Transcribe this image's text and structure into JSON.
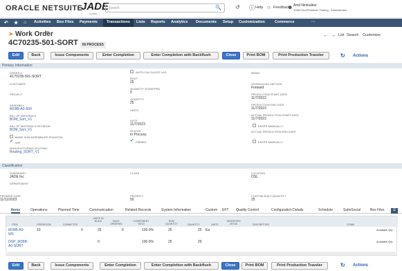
{
  "header": {
    "logo_netsuite": "ORACLE NETSUITE",
    "logo_jade": "JADE",
    "logo_jade_sub": "GLOBAL",
    "search_placeholder": "Search",
    "help": "Help",
    "feedback": "Feedback",
    "user_name": "Amit Nimbalker",
    "user_role": "JLBM Dev/Publisher Trading - Administrator"
  },
  "nav": {
    "items": [
      "Activities",
      "Box Files",
      "Payments",
      "Transactions",
      "Lists",
      "Reports",
      "Analytics",
      "Documents",
      "Setup",
      "Customization",
      "Commerce",
      "···"
    ]
  },
  "page": {
    "type_label": "Work Order",
    "record_number": "4C70235-501-SORT",
    "status_badge": "IN PROCESS",
    "list_link": "List",
    "search_link": "Search",
    "customize_link": "Customize"
  },
  "buttons": {
    "edit": "Edit",
    "back": "Back",
    "issue": "Issue Components",
    "enter_completion": "Enter Completion",
    "enter_backflush": "Enter Completion with Backflush",
    "close": "Close",
    "print_bom": "Print BOM",
    "print_traveler": "Print Production Traveler",
    "actions": "Actions"
  },
  "primary": {
    "section_label": "Primary Information",
    "order_label": "ORDER #",
    "order_value": "4C70235-501-SORT",
    "customer_label": "CUSTOMER",
    "project_label": "PROJECT",
    "assembly_label": "ASSEMBLY",
    "assembly_value": "M1BB-A0-S00",
    "bom_label": "BILL OF MATERIALS",
    "bom_value": "BOM_Sort_V1",
    "bomrev_label": "BILL OF MATERIALS REVISION",
    "bomrev_value": "BOM_Sort_V1",
    "mark_phantom": "MARK SUB-ASSEMBLIES PHANTOM",
    "wip": "WIP",
    "routing_label": "MANUFACTURING ROUTING",
    "routing_value": "Routing_SORT_V1",
    "autocalc_lag": "AUTO-CALCULATE LAG",
    "built_label": "BUILT",
    "built_value": "25",
    "qty_scrapped_label": "QUANTITY SCRAPPED",
    "qty_scrapped_value": "0",
    "quantity_label": "QUANTITY",
    "quantity_value": "25",
    "units_label": "UNITS",
    "date_label": "DATE",
    "date_value": "11/7/2023",
    "status_label": "STATUS",
    "status_value": "In Process",
    "firmed": "FIRMED",
    "memo_label": "MEMO",
    "sched_method_label": "SCHEDULING METHOD",
    "sched_method_value": "Forward",
    "prod_start_label": "PRODUCTION START DATE",
    "prod_start_value": "11/7/2023",
    "prod_end_label": "PRODUCTION END DATE",
    "prod_end_value": "11/7/2023",
    "actual_start_label": "ACTUAL PRODUCTION START DATE",
    "actual_start_value": "11/7/2023",
    "enter_manually": "ENTER MANUALLY",
    "actual_end_label": "ACTUAL PRODUCTION END DATE",
    "enter_manually2": "ENTER MANUALLY"
  },
  "classification": {
    "section_label": "Classification",
    "subsidiary_label": "SUBSIDIARY",
    "subsidiary_value": "JADE Inc",
    "department_label": "DEPARTMENT",
    "class_label": "CLASS",
    "location_label": "LOCATION",
    "location_value": "OSL",
    "promise_label": "PROMISE DATE",
    "promise_value": "11/11/2023",
    "priority_label": "PRIORITY",
    "priority_value": "50",
    "custom_qty_label": "CUSTOM BUILT QUANTITY",
    "custom_qty_value": "25"
  },
  "tabs": [
    "Items",
    "Operations",
    "Planned Time",
    "Communication",
    "Related Records",
    "System Information",
    "Custom",
    "EFT",
    "Quality Control",
    "Configuration Details",
    "Schedule",
    "SuiteSocial",
    "Box Files"
  ],
  "grid": {
    "headers": [
      "ITEM",
      "OPERATION",
      "COMMITTED",
      "UNITS IN BUILD",
      "BACK ORDERED",
      "COMPONENT YIELD",
      "BOM QUANTITY",
      "QUANTITY",
      "UNITS",
      "INVENTORY DETAIL",
      "DESCRIPTION",
      "COMM"
    ],
    "rows": [
      {
        "item": "M1BB-A0-W0",
        "operation": "10",
        "committed": "0",
        "units_in_build": "25",
        "back_ordered": "0",
        "yield": "100.0%",
        "bom_qty": "25",
        "qty": "25",
        "units": "Ea",
        "comm": "Available Qty"
      },
      {
        "item": "OSP_M1BB-A0-SORT",
        "operation": "",
        "committed": "",
        "units_in_build": "0",
        "back_ordered": "",
        "yield": "100.0%",
        "bom_qty": "25",
        "qty": "25",
        "units": "",
        "comm": "Available Qty"
      }
    ]
  }
}
